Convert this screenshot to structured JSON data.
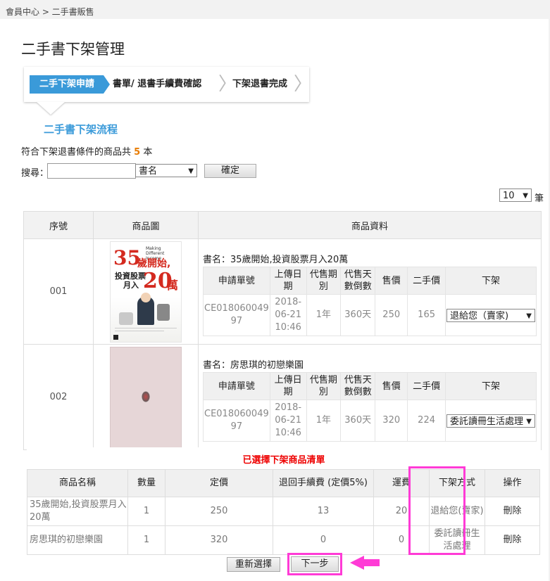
{
  "breadcrumb": "會員中心 > 二手書販售",
  "page_title": "二手書下架管理",
  "steps": [
    "二手下架申請",
    "書單/ 退書手續費確認",
    "下架退書完成"
  ],
  "flow_title": "二手書下架流程",
  "count": {
    "prefix": "符合下架退書條件的商品共",
    "value": "5",
    "suffix": "本"
  },
  "search": {
    "label": "搜尋：",
    "value": "",
    "field_select": "書名",
    "submit": "確定"
  },
  "per_page": {
    "value": "10",
    "unit": "筆"
  },
  "table": {
    "headers": [
      "序號",
      "商品圖",
      "商品資料"
    ],
    "inner_headers": [
      "申請單號",
      "上傳日期",
      "代售期別",
      "代售天數倒數",
      "售價",
      "二手價",
      "下架"
    ],
    "rows": [
      {
        "seq": "001",
        "book_label": "書名：35歲開始,投資股票月入20萬",
        "order_no": "CE018060049 97",
        "upload_date": "2018-06-21 10:46",
        "period": "1年",
        "days_left": "360天",
        "price": "250",
        "used_price": "165",
        "action": "退給您（賣家)",
        "cover_text": {
          "big1": "35",
          "line1": "歲開始,",
          "line2": "投資股票",
          "line3": "月入",
          "big2": "20",
          "big3": "萬",
          "small": "Making Different Income"
        }
      },
      {
        "seq": "002",
        "book_label": "書名：房思琪的初戀樂園",
        "order_no": "CE018060049 97",
        "upload_date": "2018-06-21 10:46",
        "period": "1年",
        "days_left": "360天",
        "price": "320",
        "used_price": "224",
        "action": "委託讀冊生活處理"
      }
    ]
  },
  "selected": {
    "title": "已選擇下架商品清單",
    "headers": [
      "商品名稱",
      "數量",
      "定價",
      "退回手續費 (定價5%)",
      "運費",
      "下架方式",
      "操作"
    ],
    "rows": [
      {
        "name": "35歲開始,投資股票月入20萬",
        "qty": "1",
        "list_price": "250",
        "fee": "13",
        "shipping": "20",
        "method": "退給您(賣家)",
        "op": "刪除"
      },
      {
        "name": "房思琪的初戀樂園",
        "qty": "1",
        "list_price": "320",
        "fee": "0",
        "shipping": "0",
        "method": "委託讀冊生活處理",
        "op": "刪除"
      }
    ],
    "reset_button": "重新選擇",
    "next_button": "下一步"
  },
  "colors": {
    "accent": "#3a9ad9",
    "highlight": "#ff3bd6",
    "warning": "#e00000",
    "count": "#e87b00"
  }
}
